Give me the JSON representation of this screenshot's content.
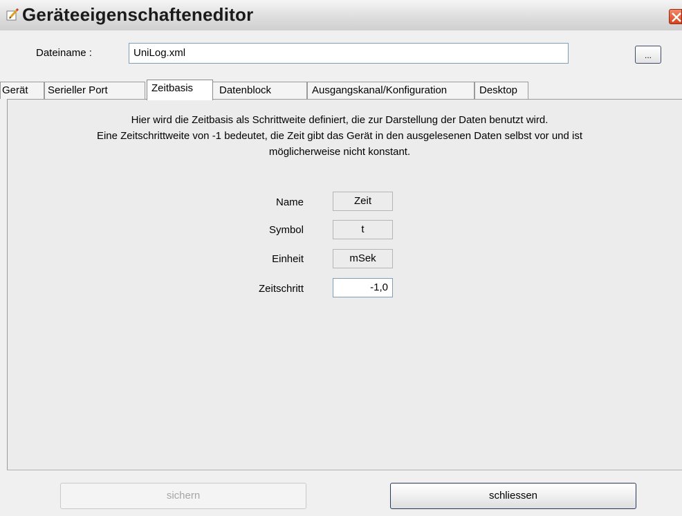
{
  "window": {
    "title": "Geräteeigenschafteneditor",
    "icon": "edit-pencil-icon",
    "close_icon": "close-icon"
  },
  "file": {
    "label": "Dateiname :",
    "value": "UniLog.xml",
    "browse_label": "..."
  },
  "tabs": [
    {
      "label": "Gerät"
    },
    {
      "label": "Serieller Port"
    },
    {
      "label": "Zeitbasis"
    },
    {
      "label": "Datenblock"
    },
    {
      "label": "Ausgangskanal/Konfiguration"
    },
    {
      "label": "Desktop"
    }
  ],
  "active_tab": "Zeitbasis",
  "panel": {
    "description": [
      "Hier wird die Zeitbasis als Schrittweite definiert, die zur Darstellung der Daten benutzt wird.",
      "Eine Zeitschrittweite von -1 bedeutet, die Zeit gibt das Gerät in den ausgelesenen Daten selbst vor und ist",
      "möglicherweise nicht konstant."
    ],
    "fields": [
      {
        "label": "Name",
        "value": "Zeit"
      },
      {
        "label": "Symbol",
        "value": "t"
      },
      {
        "label": "Einheit",
        "value": "mSek"
      },
      {
        "label": "Zeitschritt",
        "value": "-1,0"
      }
    ]
  },
  "buttons": {
    "save": "sichern",
    "close": "schliessen"
  },
  "colors": {
    "close_button": "#d9421c",
    "field_border": "#7f9db9"
  }
}
